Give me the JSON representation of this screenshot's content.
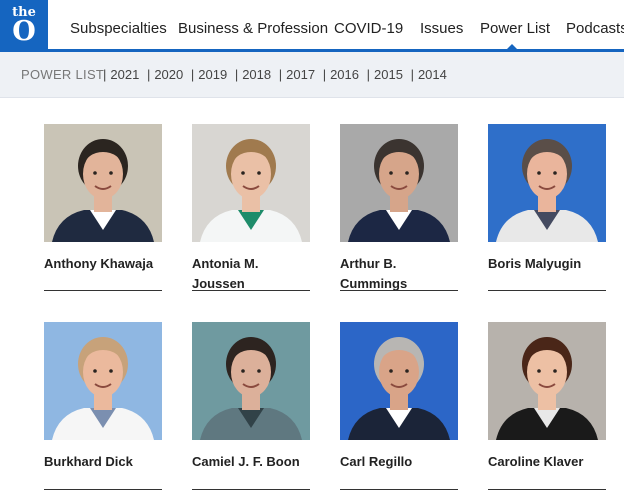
{
  "nav": {
    "logo_top": "the",
    "logo_bottom": "O",
    "items": [
      "Subspecialties",
      "Business & Profession",
      "COVID-19",
      "Issues",
      "Power List",
      "Podcasts"
    ],
    "active": "Power List"
  },
  "subnav": {
    "title": "POWER LIST",
    "years": [
      "2021",
      "2020",
      "2019",
      "2018",
      "2017",
      "2016",
      "2015",
      "2014"
    ]
  },
  "people": [
    {
      "name": "Anthony Khawaja",
      "bg": "#c9c4b6",
      "skin": "#e2b49a",
      "hair": "#2b2520",
      "shirt": "#1f2a40",
      "collar": "#ffffff"
    },
    {
      "name": "Antonia M. Joussen",
      "bg": "#d8d6d2",
      "skin": "#eac0a6",
      "hair": "#a07a4e",
      "shirt": "#f4f6f6",
      "collar": "#1e8c6a"
    },
    {
      "name": "Arthur B. Cummings",
      "bg": "#a9a9a9",
      "skin": "#d6a58a",
      "hair": "#3b3430",
      "shirt": "#1c2744",
      "collar": "#ffffff"
    },
    {
      "name": "Boris Malyugin",
      "bg": "#2f6fc9",
      "skin": "#eab59c",
      "hair": "#5a4e48",
      "shirt": "#e8e8e8",
      "collar": "#444a60"
    },
    {
      "name": "Burkhard Dick",
      "bg": "#8fb7e2",
      "skin": "#ebb99d",
      "hair": "#c7a27a",
      "shirt": "#f6f6f6",
      "collar": "#7b8fb0"
    },
    {
      "name": "Camiel J. F. Boon",
      "bg": "#6f9aa0",
      "skin": "#dcb09a",
      "hair": "#2d2420",
      "shirt": "#5f7880",
      "collar": "#314248"
    },
    {
      "name": "Carl Regillo",
      "bg": "#2c66c7",
      "skin": "#d9a488",
      "hair": "#b8b6b3",
      "shirt": "#1b2438",
      "collar": "#ffffff"
    },
    {
      "name": "Caroline Klaver",
      "bg": "#b7b2ac",
      "skin": "#edc0a4",
      "hair": "#4a2618",
      "shirt": "#1a1a1a",
      "collar": "#e8e8e8"
    }
  ]
}
